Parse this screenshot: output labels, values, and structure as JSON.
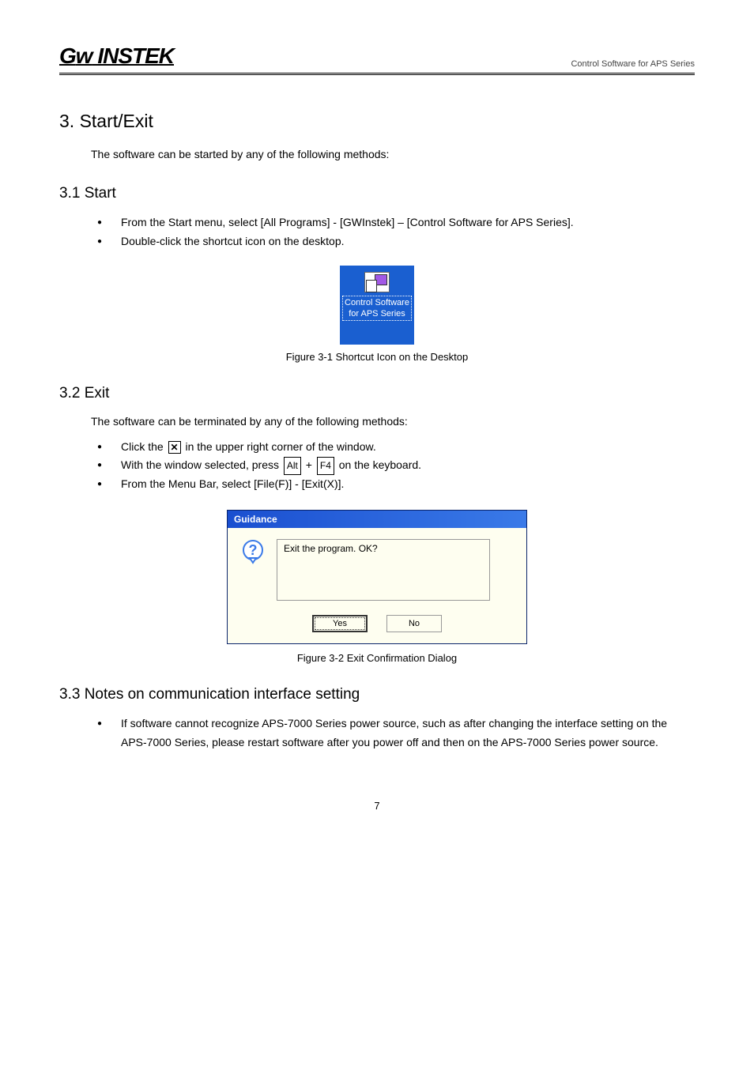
{
  "header": {
    "logo_text": "GW INSTEK",
    "right_text": "Control Software for APS Series"
  },
  "section3": {
    "title": "3. Start/Exit",
    "intro": "The software can be started by any of the following methods:"
  },
  "start": {
    "title": "3.1 Start",
    "items": [
      "From the Start menu, select [All Programs] - [GWInstek] – [Control Software for APS Series].",
      "Double-click the shortcut icon on the desktop."
    ],
    "icon_label": "Control Software for APS Series",
    "figure_caption": "Figure 3-1 Shortcut Icon on the Desktop"
  },
  "exit": {
    "title": "3.2 Exit",
    "intro_before": "The software can be terminated by any of the following methods:",
    "items": [
      {
        "before": "Click the ",
        "mid": "",
        "after": " in the upper right corner of the window."
      },
      {
        "before": "With the window selected, press ",
        "mid1": " + ",
        "mid2": " on the keyboard."
      },
      {
        "before": "From the Menu Bar, select [File(F)] - [Exit(X)].",
        "mid": "",
        "after": ""
      }
    ],
    "key_alt": "Alt",
    "key_f4": "F4",
    "dialog": {
      "title": "Guidance",
      "message": "Exit the program. OK?",
      "yes": "Yes",
      "no": "No"
    },
    "figure_caption": "Figure 3-2 Exit Confirmation Dialog"
  },
  "notes": {
    "title": "3.3 Notes on communication interface setting",
    "items": [
      "If software cannot recognize APS-7000 Series power source, such as after changing the interface setting on the APS-7000 Series, please restart software after you power off and then on the APS-7000 Series power source."
    ]
  },
  "page_number": "7"
}
